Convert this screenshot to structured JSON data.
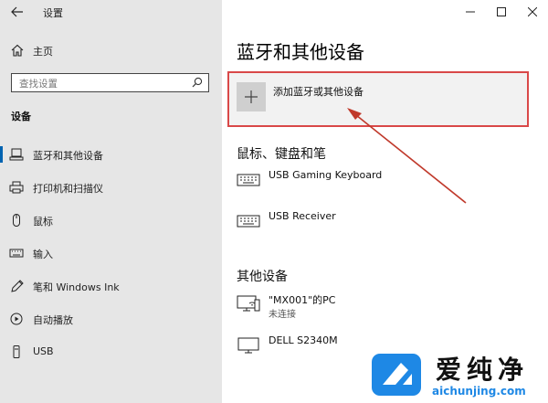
{
  "window": {
    "title": "设置",
    "controls": {
      "minimize": "—",
      "maximize": "☐",
      "close": "✕"
    }
  },
  "sidebar": {
    "home_label": "主页",
    "search_placeholder": "查找设置",
    "section_heading": "设备",
    "items": [
      {
        "label": "蓝牙和其他设备",
        "icon": "bluetooth-icon",
        "active": true
      },
      {
        "label": "打印机和扫描仪",
        "icon": "printer-icon",
        "active": false
      },
      {
        "label": "鼠标",
        "icon": "mouse-icon",
        "active": false
      },
      {
        "label": "输入",
        "icon": "keyboard-icon",
        "active": false
      },
      {
        "label": "笔和 Windows Ink",
        "icon": "pen-icon",
        "active": false
      },
      {
        "label": "自动播放",
        "icon": "autoplay-icon",
        "active": false
      },
      {
        "label": "USB",
        "icon": "usb-icon",
        "active": false
      }
    ]
  },
  "main": {
    "page_title": "蓝牙和其他设备",
    "add_device_label": "添加蓝牙或其他设备",
    "sections": [
      {
        "heading": "鼠标、键盘和笔",
        "devices": [
          {
            "name": "USB Gaming Keyboard",
            "status": "",
            "icon": "keyboard-icon"
          },
          {
            "name": "USB Receiver",
            "status": "",
            "icon": "keyboard-icon"
          }
        ]
      },
      {
        "heading": "其他设备",
        "devices": [
          {
            "name": "\"MX001\"的PC",
            "status": "未连接",
            "icon": "pc-icon"
          },
          {
            "name": "DELL S2340M",
            "status": "",
            "icon": "monitor-icon"
          }
        ]
      }
    ]
  },
  "annotation": {
    "highlight_color": "#d94848",
    "arrow_color": "#c0392b"
  },
  "watermark": {
    "text_cn": "爱纯净",
    "url": "aichunjing.com",
    "accent": "#1e88e5"
  },
  "colors": {
    "sidebar_bg": "#e6e6e6",
    "accent": "#0063b1"
  }
}
